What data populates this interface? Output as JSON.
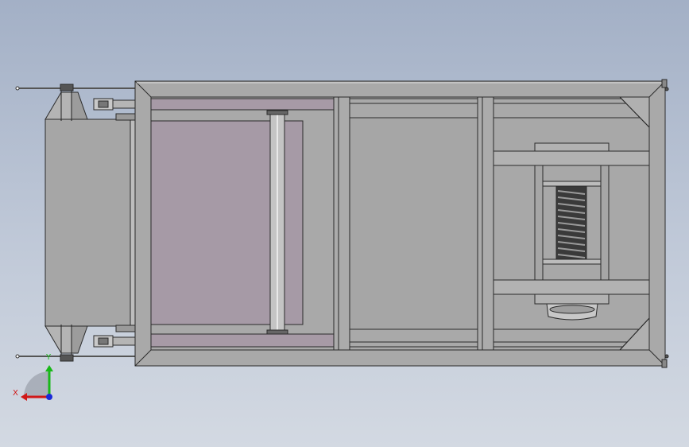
{
  "viewport": {
    "background_top": "#a3b0c6",
    "background_bottom": "#d3d9e2"
  },
  "model": {
    "part_fill": "#a9a9a9",
    "part_stroke": "#2a2a2a",
    "panel_fill": "#a69aa6",
    "roller_fill": "#c4c4c4",
    "spring_fill": "#3a3a3a"
  },
  "triad": {
    "x_label": "X",
    "y_label": "Y",
    "x_color": "#d01818",
    "y_color": "#18b818",
    "z_color": "#1a2ad8"
  }
}
